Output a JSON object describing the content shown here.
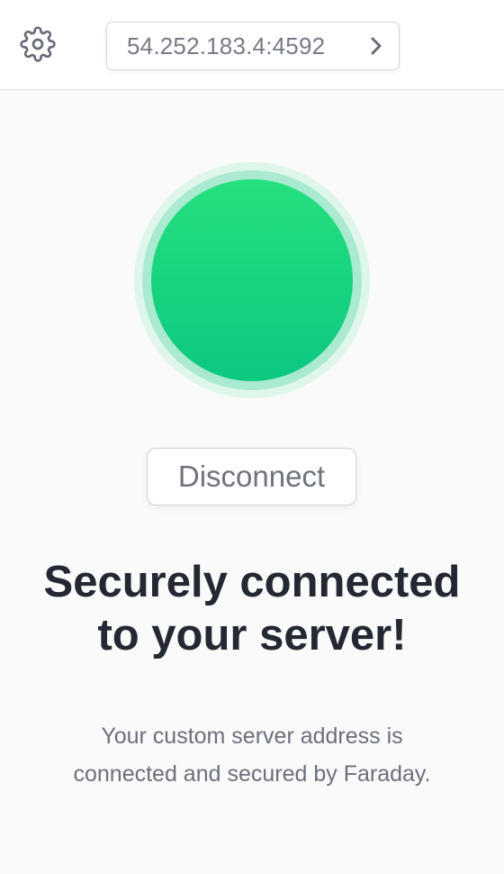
{
  "header": {
    "settings_icon": "gear-icon",
    "server_address": "54.252.183.4:4592",
    "chevron_icon": "chevron-right-icon"
  },
  "status": {
    "state": "connected",
    "orb_color": "#12d07f",
    "orb_ring_color": "#a9ead0",
    "orb_halo_color": "#dff7ea"
  },
  "actions": {
    "disconnect_label": "Disconnect"
  },
  "message": {
    "headline_line1": "Securely connected",
    "headline_line2": "to your server!",
    "body_line1": "Your custom server address is",
    "body_line2": "connected and secured by Faraday."
  },
  "colors": {
    "headline": "#232833",
    "body": "#6c707b",
    "background": "#fafafa"
  }
}
